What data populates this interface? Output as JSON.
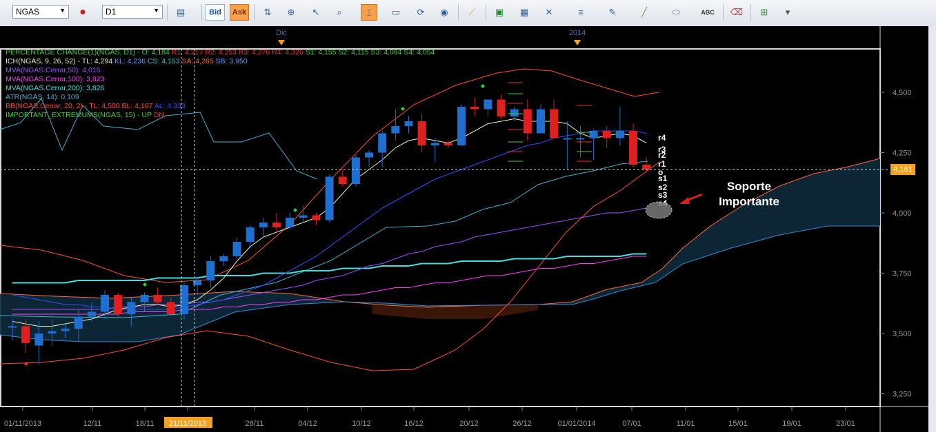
{
  "toolbar": {
    "symbol": "NGAS",
    "timeframe": "D1",
    "bid_label": "Bid",
    "ask_label": "Ask",
    "icons": [
      "globe-order-icon",
      "chart-type-icon",
      "buy-sell-icon",
      "zoom-icon",
      "magnify-icon",
      "crosshair-icon",
      "screenshot-icon",
      "refresh-icon",
      "internet-icon",
      "ruler-icon",
      "image-icon",
      "save-icon",
      "tools-icon",
      "lines-icon",
      "pen-icon",
      "trendline-icon",
      "ellipse-icon",
      "text-icon",
      "eraser-icon",
      "network-icon",
      "settings-icon"
    ]
  },
  "legend": [
    {
      "text": "PERCENTAGE CHANGE(1)(NGAS, D1) -  O: 4,184  ",
      "color": "#3cd13c",
      "parts": [
        {
          "t": "PERCENTAGE CHANGE(1)(NGAS, D1) -  O: 4,184  ",
          "c": "#3cd13c"
        },
        {
          "t": "R1: 4,217  R2: 4,253  R3: 4,276  R4: 4,326  ",
          "c": "#ee3030"
        },
        {
          "t": "S1: 4,155  S2: 4,115  S3: 4,084  S4: 4,054",
          "c": "#3cd13c"
        }
      ]
    },
    {
      "parts": [
        {
          "t": "ICH(NGAS, 9, 26, 52) -  ",
          "c": "#f0f0c0"
        },
        {
          "t": "TL: 4,294  ",
          "c": "#f0f0c0"
        },
        {
          "t": "KL: 4,236  ",
          "c": "#5aa0ff"
        },
        {
          "t": "CS: 4,153  ",
          "c": "#3cc8c8"
        },
        {
          "t": "SA: 4,265  ",
          "c": "#ff6a3a"
        },
        {
          "t": "SB: 3,950",
          "c": "#5aa0ff"
        }
      ]
    },
    {
      "parts": [
        {
          "t": "MVA(NGAS.Cerrar,50): 4,015",
          "c": "#a050ff"
        }
      ]
    },
    {
      "parts": [
        {
          "t": "MVA(NGAS.Cerrar,100): 3,823",
          "c": "#ff40ff"
        }
      ]
    },
    {
      "parts": [
        {
          "t": "MVA(NGAS.Cerrar,200): 3,826",
          "c": "#40e0e0"
        }
      ]
    },
    {
      "parts": [
        {
          "t": "ATR(NGAS, 14): 0,109",
          "c": "#48b0d0"
        }
      ]
    },
    {
      "parts": [
        {
          "t": "BB(NGAS.Cerrar, 20, 2) -  ",
          "c": "#ff5030"
        },
        {
          "t": "TL: 4,500  ",
          "c": "#ff5030"
        },
        {
          "t": "BL: 4,167  ",
          "c": "#ff5030"
        },
        {
          "t": "AL: 4,333",
          "c": "#3050ff"
        }
      ]
    },
    {
      "parts": [
        {
          "t": "IMPORTANT_EXTREMUMS(NGAS, 15) -  ",
          "c": "#3cd13c"
        },
        {
          "t": "UP  ",
          "c": "#3cd13c"
        },
        {
          "t": "DN",
          "c": "#ee3030"
        }
      ]
    }
  ],
  "annotation": {
    "line1": "Soporte",
    "line2": "Importante"
  },
  "current_price": "4,181",
  "pivot_labels": [
    "r4",
    "r3",
    "r2",
    "r1",
    "o",
    "s1",
    "s2",
    "s3",
    "s4"
  ],
  "chart_data": {
    "type": "candlestick",
    "symbol": "NGAS",
    "timeframe": "D1",
    "ylim": [
      3.18,
      4.68
    ],
    "y_ticks": [
      "4,500",
      "4,250",
      "4,000",
      "3,750",
      "3,500",
      "3,250"
    ],
    "y_tick_values": [
      4.5,
      4.25,
      4.0,
      3.75,
      3.5,
      3.25
    ],
    "x_labels": [
      "01/11/2013",
      "12/11",
      "18/11",
      "21/11/2013",
      "28/11",
      "04/12",
      "10/12",
      "16/12",
      "20/12",
      "26/12",
      "01/01/2014",
      "07/01",
      "11/01",
      "15/01",
      "19/01",
      "23/01"
    ],
    "top_labels": [
      "Dic",
      "2014"
    ],
    "highlight_x_label": "21/11/2013",
    "candles": [
      {
        "o": 3.53,
        "h": 3.56,
        "l": 3.47,
        "c": 3.53
      },
      {
        "o": 3.53,
        "h": 3.56,
        "l": 3.42,
        "c": 3.46
      },
      {
        "o": 3.45,
        "h": 3.55,
        "l": 3.37,
        "c": 3.5
      },
      {
        "o": 3.5,
        "h": 3.56,
        "l": 3.45,
        "c": 3.51
      },
      {
        "o": 3.51,
        "h": 3.54,
        "l": 3.48,
        "c": 3.52
      },
      {
        "o": 3.52,
        "h": 3.6,
        "l": 3.47,
        "c": 3.57
      },
      {
        "o": 3.57,
        "h": 3.63,
        "l": 3.55,
        "c": 3.59
      },
      {
        "o": 3.59,
        "h": 3.68,
        "l": 3.56,
        "c": 3.66
      },
      {
        "o": 3.66,
        "h": 3.67,
        "l": 3.57,
        "c": 3.58
      },
      {
        "o": 3.58,
        "h": 3.65,
        "l": 3.53,
        "c": 3.63
      },
      {
        "o": 3.63,
        "h": 3.67,
        "l": 3.59,
        "c": 3.66
      },
      {
        "o": 3.66,
        "h": 3.69,
        "l": 3.62,
        "c": 3.63
      },
      {
        "o": 3.63,
        "h": 3.65,
        "l": 3.59,
        "c": 3.58
      },
      {
        "o": 3.58,
        "h": 3.71,
        "l": 3.56,
        "c": 3.7
      },
      {
        "o": 3.7,
        "h": 3.74,
        "l": 3.66,
        "c": 3.72
      },
      {
        "o": 3.72,
        "h": 3.82,
        "l": 3.69,
        "c": 3.8
      },
      {
        "o": 3.8,
        "h": 3.83,
        "l": 3.78,
        "c": 3.82
      },
      {
        "o": 3.82,
        "h": 3.9,
        "l": 3.8,
        "c": 3.88
      },
      {
        "o": 3.88,
        "h": 3.95,
        "l": 3.85,
        "c": 3.94
      },
      {
        "o": 3.94,
        "h": 3.98,
        "l": 3.9,
        "c": 3.96
      },
      {
        "o": 3.96,
        "h": 4.0,
        "l": 3.92,
        "c": 3.94
      },
      {
        "o": 3.94,
        "h": 4.0,
        "l": 3.93,
        "c": 3.98
      },
      {
        "o": 3.98,
        "h": 4.03,
        "l": 3.96,
        "c": 3.99
      },
      {
        "o": 3.99,
        "h": 4.0,
        "l": 3.95,
        "c": 3.97
      },
      {
        "o": 3.97,
        "h": 4.16,
        "l": 3.96,
        "c": 4.15
      },
      {
        "o": 4.15,
        "h": 4.18,
        "l": 4.11,
        "c": 4.12
      },
      {
        "o": 4.12,
        "h": 4.24,
        "l": 4.11,
        "c": 4.23
      },
      {
        "o": 4.23,
        "h": 4.26,
        "l": 4.19,
        "c": 4.25
      },
      {
        "o": 4.25,
        "h": 4.34,
        "l": 4.19,
        "c": 4.33
      },
      {
        "o": 4.33,
        "h": 4.43,
        "l": 4.3,
        "c": 4.36
      },
      {
        "o": 4.36,
        "h": 4.4,
        "l": 4.33,
        "c": 4.38
      },
      {
        "o": 4.38,
        "h": 4.41,
        "l": 4.25,
        "c": 4.28
      },
      {
        "o": 4.28,
        "h": 4.31,
        "l": 4.21,
        "c": 4.29
      },
      {
        "o": 4.29,
        "h": 4.3,
        "l": 4.27,
        "c": 4.28
      },
      {
        "o": 4.28,
        "h": 4.45,
        "l": 4.28,
        "c": 4.44
      },
      {
        "o": 4.44,
        "h": 4.48,
        "l": 4.4,
        "c": 4.43
      },
      {
        "o": 4.43,
        "h": 4.47,
        "l": 4.4,
        "c": 4.47
      },
      {
        "o": 4.47,
        "h": 4.49,
        "l": 4.39,
        "c": 4.4
      },
      {
        "o": 4.4,
        "h": 4.44,
        "l": 4.38,
        "c": 4.43
      },
      {
        "o": 4.43,
        "h": 4.47,
        "l": 4.3,
        "c": 4.33
      },
      {
        "o": 4.33,
        "h": 4.45,
        "l": 4.33,
        "c": 4.43
      },
      {
        "o": 4.43,
        "h": 4.47,
        "l": 4.31,
        "c": 4.31
      },
      {
        "o": 4.31,
        "h": 4.38,
        "l": 4.18,
        "c": 4.31
      },
      {
        "o": 4.31,
        "h": 4.36,
        "l": 4.23,
        "c": 4.31
      },
      {
        "o": 4.31,
        "h": 4.35,
        "l": 4.22,
        "c": 4.34
      },
      {
        "o": 4.34,
        "h": 4.36,
        "l": 4.27,
        "c": 4.31
      },
      {
        "o": 4.31,
        "h": 4.44,
        "l": 4.28,
        "c": 4.34
      },
      {
        "o": 4.34,
        "h": 4.37,
        "l": 4.19,
        "c": 4.2
      },
      {
        "o": 4.2,
        "h": 4.23,
        "l": 4.17,
        "c": 4.18
      }
    ],
    "series": [
      {
        "name": "MVA(NGAS.Cerrar,200)",
        "color": "#40e0e0",
        "values": [
          3.71,
          3.71,
          3.71,
          3.71,
          3.71,
          3.72,
          3.72,
          3.72,
          3.72,
          3.72,
          3.72,
          3.73,
          3.73,
          3.73,
          3.73,
          3.74,
          3.74,
          3.74,
          3.74,
          3.75,
          3.75,
          3.75,
          3.76,
          3.76,
          3.76,
          3.77,
          3.77,
          3.77,
          3.78,
          3.78,
          3.78,
          3.79,
          3.79,
          3.79,
          3.8,
          3.8,
          3.8,
          3.8,
          3.81,
          3.81,
          3.81,
          3.81,
          3.82,
          3.82,
          3.82,
          3.82,
          3.82,
          3.83,
          3.83
        ]
      },
      {
        "name": "MVA(NGAS.Cerrar,100)",
        "color": "#ff40ff",
        "values": [
          3.58,
          3.58,
          3.58,
          3.58,
          3.58,
          3.58,
          3.58,
          3.58,
          3.58,
          3.59,
          3.59,
          3.59,
          3.59,
          3.6,
          3.6,
          3.6,
          3.61,
          3.61,
          3.62,
          3.62,
          3.63,
          3.63,
          3.64,
          3.64,
          3.65,
          3.66,
          3.66,
          3.67,
          3.68,
          3.69,
          3.69,
          3.7,
          3.71,
          3.71,
          3.72,
          3.73,
          3.74,
          3.74,
          3.75,
          3.76,
          3.77,
          3.77,
          3.78,
          3.79,
          3.79,
          3.8,
          3.81,
          3.82,
          3.82
        ]
      },
      {
        "name": "MVA(NGAS.Cerrar,50)",
        "color": "#a050ff",
        "values": [
          3.6,
          3.6,
          3.6,
          3.6,
          3.6,
          3.6,
          3.6,
          3.6,
          3.61,
          3.61,
          3.61,
          3.62,
          3.62,
          3.62,
          3.63,
          3.63,
          3.64,
          3.65,
          3.66,
          3.67,
          3.68,
          3.69,
          3.7,
          3.72,
          3.73,
          3.74,
          3.76,
          3.78,
          3.79,
          3.81,
          3.83,
          3.84,
          3.86,
          3.87,
          3.88,
          3.9,
          3.91,
          3.92,
          3.93,
          3.94,
          3.95,
          3.96,
          3.97,
          3.98,
          3.99,
          4.0,
          4.0,
          4.01,
          4.02
        ]
      },
      {
        "name": "KL",
        "color": "#3050ff",
        "values": [
          3.66,
          3.65,
          3.64,
          3.63,
          3.62,
          3.62,
          3.61,
          3.61,
          3.6,
          3.6,
          3.6,
          3.6,
          3.6,
          3.61,
          3.62,
          3.63,
          3.64,
          3.66,
          3.68,
          3.7,
          3.73,
          3.76,
          3.79,
          3.82,
          3.86,
          3.9,
          3.94,
          3.98,
          4.02,
          4.05,
          4.08,
          4.11,
          4.14,
          4.16,
          4.18,
          4.2,
          4.22,
          4.24,
          4.26,
          4.28,
          4.29,
          4.31,
          4.32,
          4.33,
          4.34,
          4.34,
          4.34,
          4.34,
          4.33
        ]
      },
      {
        "name": "TL",
        "color": "#f0f0c0",
        "values": [
          3.55,
          3.54,
          3.53,
          3.53,
          3.54,
          3.55,
          3.56,
          3.58,
          3.6,
          3.61,
          3.62,
          3.62,
          3.61,
          3.62,
          3.64,
          3.68,
          3.73,
          3.8,
          3.86,
          3.9,
          3.92,
          3.94,
          3.96,
          3.98,
          4.02,
          4.08,
          4.14,
          4.18,
          4.22,
          4.27,
          4.3,
          4.31,
          4.3,
          4.29,
          4.31,
          4.34,
          4.37,
          4.38,
          4.39,
          4.38,
          4.38,
          4.38,
          4.37,
          4.33,
          4.31,
          4.32,
          4.33,
          4.32,
          4.29
        ]
      }
    ],
    "pivot_levels": {
      "R4": 4.326,
      "R3": 4.276,
      "R2": 4.253,
      "R1": 4.217,
      "O": 4.184,
      "S1": 4.155,
      "S2": 4.115,
      "S3": 4.084,
      "S4": 4.054
    }
  }
}
